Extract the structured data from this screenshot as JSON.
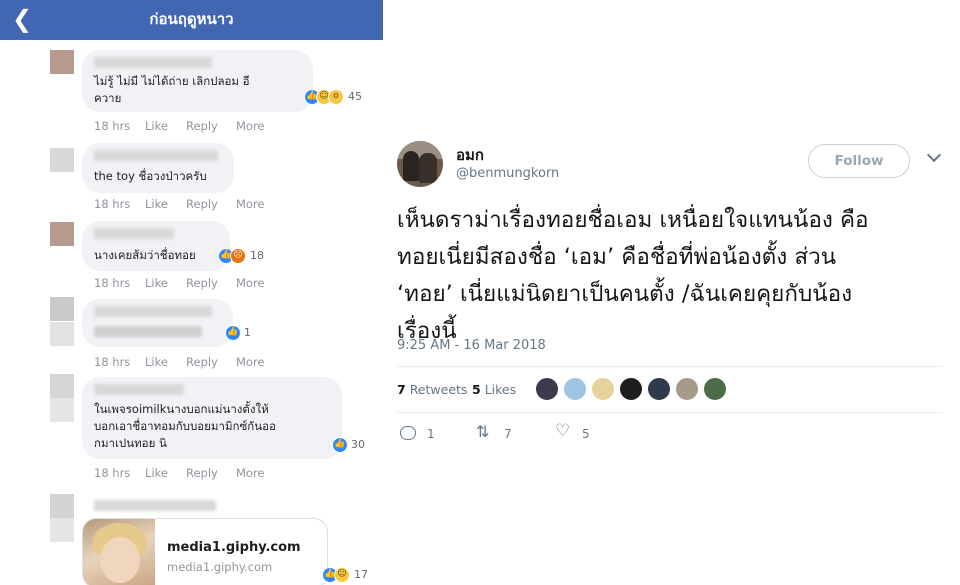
{
  "facebook": {
    "header_title": "ก่อนฤดูหนาว",
    "back_icon": "chevron-left-icon",
    "meta_labels": {
      "like": "Like",
      "reply": "Reply",
      "more": "More"
    },
    "comments": [
      {
        "text": "ไม่รู้ ไม่มี ไม่ได้ถ่าย เลิกปลอม อี\nควาย",
        "time": "18 hrs",
        "reactions": [
          "like",
          "haha",
          "wow"
        ],
        "reaction_count": "45"
      },
      {
        "text": "the toy ชื่อวงป่าวครับ",
        "time": "18 hrs",
        "reactions": [],
        "reaction_count": ""
      },
      {
        "text": "นางเคยส้มว่าชื่อทอย",
        "time": "18 hrs",
        "reactions": [
          "like",
          "angry"
        ],
        "reaction_count": "18"
      },
      {
        "text": "",
        "time": "18 hrs",
        "reactions": [
          "like"
        ],
        "reaction_count": "1"
      },
      {
        "text": "ในเพจรoimilkนางบอกแม่นางตั้งให้\nบอกเอาชื่อาทอมกับบอยมามิกซ์กันออ\nกมาเปนทอย นิ",
        "time": "18 hrs",
        "reactions": [
          "like"
        ],
        "reaction_count": "30"
      }
    ],
    "link_card": {
      "title": "media1.giphy.com",
      "domain": "media1.giphy.com",
      "reactions": [
        "like",
        "haha"
      ],
      "reaction_count": "17"
    }
  },
  "tweet": {
    "display_name": "อมก",
    "handle": "@benmungkorn",
    "follow_label": "Follow",
    "text_lines": [
      "เห็นดราม่าเรื่องทอยชื่อเอม เหนื่อยใจแทนน้อง คือ",
      "ทอยเนี่ยมีสองชื่อ ‘เอม’ คือชื่อที่พ่อน้องตั้ง ส่วน",
      "‘ทอย’ เนี่ยแม่นิดยาเป็นคนตั้ง /ฉันเคยคุยกับน้อง",
      "เรื่องนี้"
    ],
    "timestamp": "9:25 AM - 16 Mar 2018",
    "retweets_count": "7",
    "retweets_label": "Retweets",
    "likes_count": "5",
    "likes_label": "Likes",
    "liker_colors": [
      "#3d3a4e",
      "#9ec5e4",
      "#e8d29b",
      "#1e1e1e",
      "#2f3a4a",
      "#a89a8a",
      "#4d6a4a"
    ],
    "actions": {
      "reply_count": "1",
      "retweet_count": "7",
      "like_count": "5"
    }
  }
}
